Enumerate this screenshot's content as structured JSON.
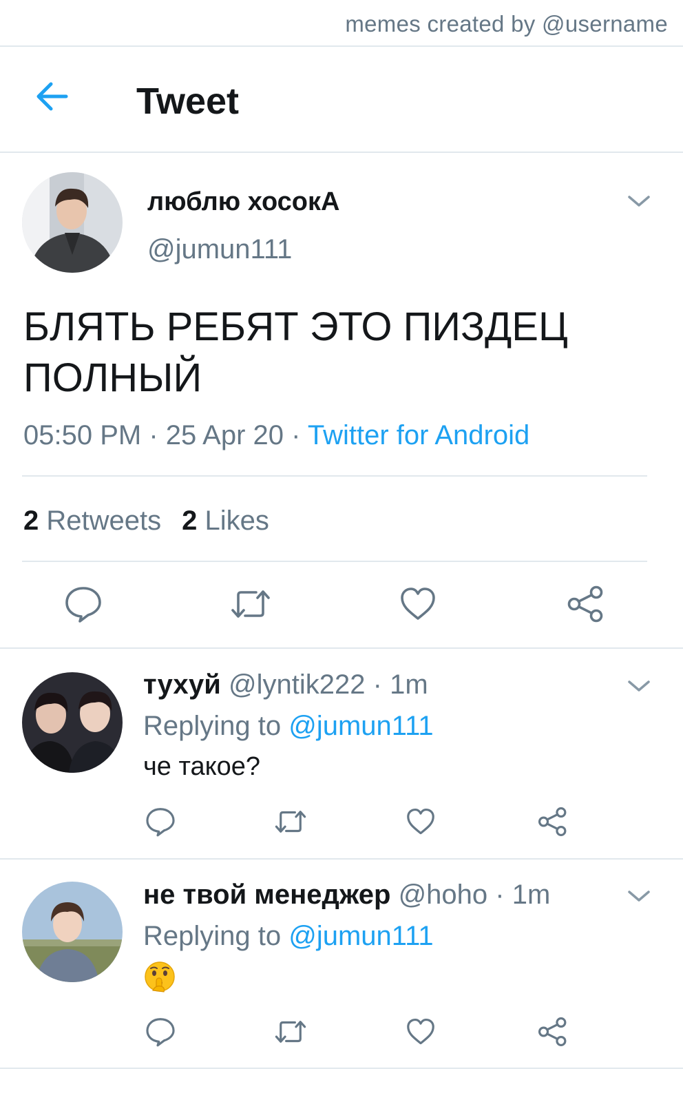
{
  "watermark": "memes created by @username",
  "header": {
    "title": "Tweet"
  },
  "tweet": {
    "name": "люблю хосокА",
    "handle": "@jumun111",
    "text": "БЛЯТЬ РЕБЯТ ЭТО ПИЗДЕЦ ПОЛНЫЙ",
    "time": "05:50 PM",
    "date": "25 Apr 20",
    "source": "Twitter for Android",
    "retweets_count": "2",
    "retweets_label": "Retweets",
    "likes_count": "2",
    "likes_label": "Likes"
  },
  "replies": [
    {
      "name": "тухуй",
      "handle": "@lyntik222",
      "time": "1m",
      "replying_prefix": "Replying to",
      "replying_to": "@jumun111",
      "text": "че такое?"
    },
    {
      "name": "не твой менеджер",
      "handle": "@hoho",
      "time": "1m",
      "replying_prefix": "Replying to",
      "replying_to": "@jumun111",
      "text": "🤫"
    }
  ],
  "icons": {
    "back": "arrow-left-icon",
    "more": "chevron-down-icon",
    "reply": "speech-bubble-icon",
    "retweet": "retweet-icon",
    "like": "heart-icon",
    "share": "share-icon",
    "emoji": "shushing-face-emoji"
  },
  "colors": {
    "accent": "#1da1f2",
    "secondary_text": "#657786",
    "divider": "#e1e8ed"
  }
}
